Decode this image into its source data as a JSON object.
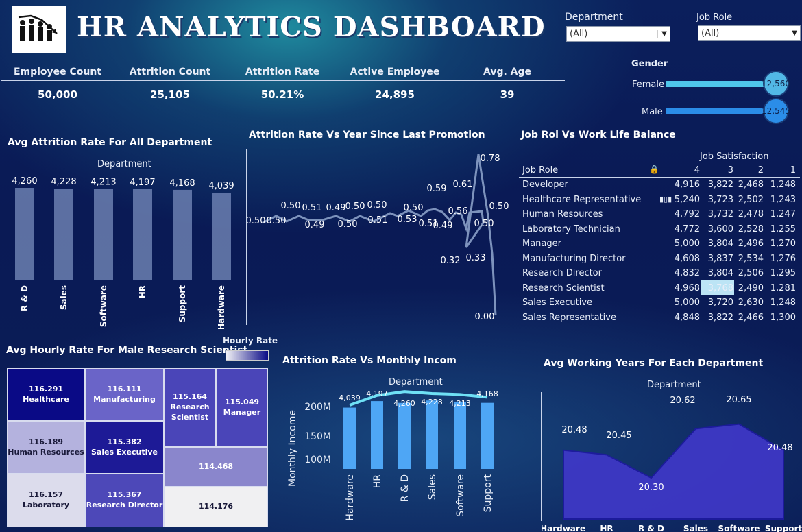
{
  "header": {
    "title": "HR ANALYTICS DASHBOARD",
    "logo": "employees-chart-icon"
  },
  "filters": {
    "department": {
      "label": "Department",
      "value": "(All)"
    },
    "job_role": {
      "label": "Job Role",
      "value": "(All)"
    }
  },
  "kpis": [
    {
      "label": "Employee Count",
      "value": "50,000"
    },
    {
      "label": "Attrition Count",
      "value": "25,105"
    },
    {
      "label": "Attrition Rate",
      "value": "50.21%"
    },
    {
      "label": "Active Employee",
      "value": "24,895"
    },
    {
      "label": "Avg. Age",
      "value": "39"
    }
  ],
  "gender": {
    "title": "Gender",
    "items": [
      {
        "label": "Female",
        "value": 12560,
        "display": "12,560"
      },
      {
        "label": "Male",
        "value": 12545,
        "display": "12,545"
      }
    ]
  },
  "colors": {
    "bar_light": "#6b7fb0",
    "bar_blue": "#4ea6f5",
    "line_cyan": "#6fe0f5",
    "area_purple": "#3f38c8",
    "gender_cyan": "#4fc6ea",
    "gender_blue": "#2b8de8"
  },
  "chart_data": [
    {
      "type": "bar",
      "title": "Avg Attrition Rate For All Department",
      "subtitle": "Department",
      "categories": [
        "R & D",
        "Sales",
        "Software",
        "HR",
        "Support",
        "Hardware"
      ],
      "values": [
        4260,
        4228,
        4213,
        4197,
        4168,
        4039
      ],
      "labels": [
        "4,260",
        "4,228",
        "4,213",
        "4,197",
        "4,168",
        "4,039"
      ]
    },
    {
      "type": "line",
      "title": "Attrition Rate Vs Year Since Last Promotion",
      "labels": [
        "0.50",
        "0.50",
        "0.50",
        "0.51",
        "0.49",
        "0.49",
        "0.50",
        "0.50",
        "0.51",
        "0.50",
        "0.53",
        "0.50",
        "0.51",
        "0.59",
        "0.49",
        "0.61",
        "0.56",
        "0.32",
        "0.33",
        "0.78",
        "0.50",
        "0.50",
        "0.00"
      ]
    },
    {
      "type": "table",
      "title": "Job Rol Vs Work Life Balance",
      "column_group": "Job Satisfaction",
      "row_header": "Job Role",
      "columns": [
        "4",
        "3",
        "2",
        "1"
      ],
      "rows": [
        {
          "role": "Developer",
          "values": [
            "4,916",
            "3,822",
            "2,468",
            "1,248"
          ]
        },
        {
          "role": "Healthcare Representative",
          "values": [
            "5,240",
            "3,723",
            "2,502",
            "1,243"
          ]
        },
        {
          "role": "Human Resources",
          "values": [
            "4,792",
            "3,732",
            "2,478",
            "1,247"
          ]
        },
        {
          "role": "Laboratory Technician",
          "values": [
            "4,772",
            "3,600",
            "2,528",
            "1,255"
          ]
        },
        {
          "role": "Manager",
          "values": [
            "5,000",
            "3,804",
            "2,496",
            "1,270"
          ]
        },
        {
          "role": "Manufacturing Director",
          "values": [
            "4,608",
            "3,837",
            "2,534",
            "1,276"
          ]
        },
        {
          "role": "Research Director",
          "values": [
            "4,832",
            "3,804",
            "2,506",
            "1,295"
          ]
        },
        {
          "role": "Research Scientist",
          "values": [
            "4,968",
            "3,768",
            "2,490",
            "1,281"
          ]
        },
        {
          "role": "Sales Executive",
          "values": [
            "5,000",
            "3,720",
            "2,630",
            "1,248"
          ]
        },
        {
          "role": "Sales Representative",
          "values": [
            "4,848",
            "3,822",
            "2,466",
            "1,300"
          ]
        }
      ]
    },
    {
      "type": "heatmap",
      "title": "Avg Hourly Rate For Male Research Scientist",
      "legend": "Hourly Rate",
      "cells": [
        {
          "value": "116.291",
          "label": "Healthcare",
          "color": "#0a0a86"
        },
        {
          "value": "116.111",
          "label": "Manufacturing",
          "color": "#6a64c8"
        },
        {
          "value": "115.164",
          "label": "Research Scientist",
          "color": "#4a45b8"
        },
        {
          "value": "115.049",
          "label": "Manager",
          "color": "#4a45b8"
        },
        {
          "value": "116.189",
          "label": "Human Resources",
          "color": "#b4b2de"
        },
        {
          "value": "115.382",
          "label": "Sales Executive",
          "color": "#1d1a96"
        },
        {
          "value": "114.468",
          "label": "",
          "color": "#8a86cc"
        },
        {
          "value": "116.157",
          "label": "Laboratory",
          "color": "#dcdcec"
        },
        {
          "value": "115.367",
          "label": "Research Director",
          "color": "#4d48b8"
        },
        {
          "value": "114.176",
          "label": "",
          "color": "#f0f0f2"
        }
      ]
    },
    {
      "type": "bar",
      "title": "Attrition Rate Vs Monthly Incom",
      "subtitle": "Department",
      "ylabel": "Monthly Income",
      "yticks": [
        "200M",
        "150M",
        "100M"
      ],
      "categories": [
        "Hardware",
        "HR",
        "R & D",
        "Sales",
        "Software",
        "Support"
      ],
      "values": [
        204,
        215,
        212,
        216,
        214,
        212
      ],
      "line_labels": [
        "4,039",
        "4,197",
        "4,260",
        "4,228",
        "4,213",
        "4,168"
      ],
      "line_values": [
        4039,
        4197,
        4260,
        4228,
        4213,
        4168
      ]
    },
    {
      "type": "area",
      "title": "Avg Working Years For Each Department",
      "subtitle": "Department",
      "categories": [
        "Hardware",
        "HR",
        "R & D",
        "Sales",
        "Software",
        "Support"
      ],
      "values": [
        20.48,
        20.45,
        20.3,
        20.62,
        20.65,
        20.48
      ],
      "labels": [
        "20.48",
        "20.45",
        "20.30",
        "20.62",
        "20.65",
        "20.48"
      ]
    }
  ]
}
